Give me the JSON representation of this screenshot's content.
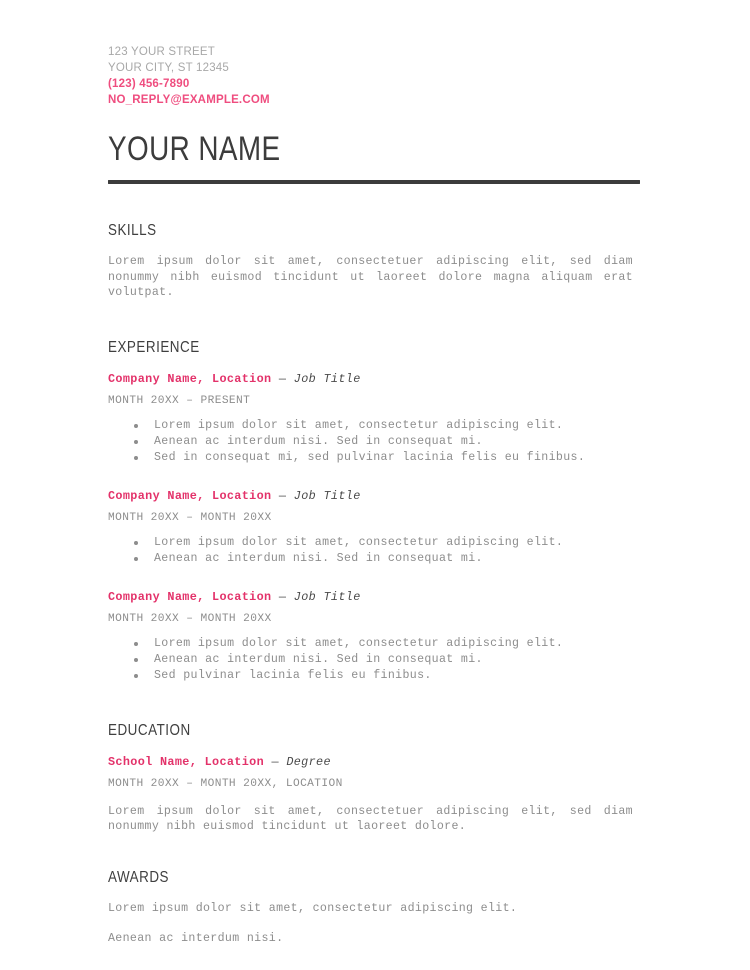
{
  "document": {
    "type": "resume",
    "accent_color": "#e3326a",
    "accent_color_light": "#ef4d7f",
    "heading_color": "#3c3c3c",
    "body_color": "#8d8d8d",
    "rule_color": "#3c3c3c",
    "background": "#ffffff"
  },
  "header": {
    "contact": [
      {
        "text": "123 YOUR STREET",
        "style": "muted"
      },
      {
        "text": "YOUR CITY, ST 12345",
        "style": "muted"
      },
      {
        "text": "(123) 456-7890",
        "style": "accent"
      },
      {
        "text": "NO_REPLY@EXAMPLE.COM",
        "style": "accent"
      }
    ],
    "name": "YOUR NAME"
  },
  "sections": {
    "skills": {
      "title": "SKILLS",
      "paragraph": "Lorem ipsum dolor sit amet, consectetuer adipiscing elit, sed diam nonummy nibh euismod tincidunt ut laoreet dolore magna aliquam erat volutpat."
    },
    "experience": {
      "title": "EXPERIENCE",
      "entries": [
        {
          "organization": "Company Name, Location",
          "separator": "—",
          "role": "Job Title",
          "dates": "MONTH 20XX – PRESENT",
          "bullets": [
            "Lorem ipsum dolor sit amet, consectetur adipiscing elit.",
            "Aenean ac interdum nisi. Sed in consequat mi.",
            "Sed in consequat mi, sed pulvinar lacinia felis eu finibus."
          ]
        },
        {
          "organization": "Company Name, Location",
          "separator": "—",
          "role": "Job Title",
          "dates": "MONTH 20XX – MONTH 20XX",
          "bullets": [
            "Lorem ipsum dolor sit amet, consectetur adipiscing elit.",
            "Aenean ac interdum nisi. Sed in consequat mi."
          ]
        },
        {
          "organization": "Company Name, Location",
          "separator": "—",
          "role": "Job Title",
          "dates": "MONTH 20XX – MONTH 20XX",
          "bullets": [
            "Lorem ipsum dolor sit amet, consectetur adipiscing elit.",
            "Aenean ac interdum nisi. Sed in consequat mi.",
            "Sed pulvinar lacinia felis eu finibus."
          ]
        }
      ]
    },
    "education": {
      "title": "EDUCATION",
      "entry": {
        "organization": "School Name, Location",
        "separator": "—",
        "role": "Degree",
        "dates": "MONTH 20XX – MONTH 20XX, LOCATION",
        "paragraph": "Lorem ipsum dolor sit amet, consectetuer adipiscing elit, sed diam nonummy nibh euismod tincidunt ut laoreet dolore."
      }
    },
    "awards": {
      "title": "AWARDS",
      "lines": [
        "Lorem ipsum dolor sit amet, consectetur adipiscing elit.",
        "Aenean ac interdum nisi."
      ]
    }
  }
}
